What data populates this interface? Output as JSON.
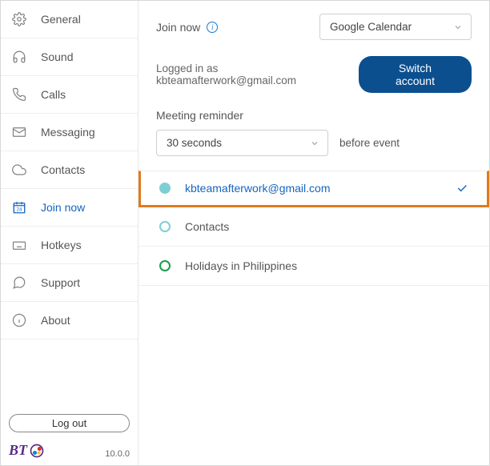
{
  "sidebar": {
    "items": [
      {
        "label": "General"
      },
      {
        "label": "Sound"
      },
      {
        "label": "Calls"
      },
      {
        "label": "Messaging"
      },
      {
        "label": "Contacts"
      },
      {
        "label": "Join now"
      },
      {
        "label": "Hotkeys"
      },
      {
        "label": "Support"
      },
      {
        "label": "About"
      }
    ],
    "logout": "Log out",
    "version": "10.0.0",
    "brand": "BT"
  },
  "main": {
    "title": "Join now",
    "calendar_source": "Google Calendar",
    "logged_in": "Logged in as kbteamafterwork@gmail.com",
    "switch_label": "Switch account",
    "reminder_label": "Meeting reminder",
    "reminder_value": "30 seconds",
    "reminder_suffix": "before event",
    "calendars": [
      {
        "label": "kbteamafterwork@gmail.com"
      },
      {
        "label": "Contacts"
      },
      {
        "label": "Holidays in Philippines"
      }
    ]
  }
}
